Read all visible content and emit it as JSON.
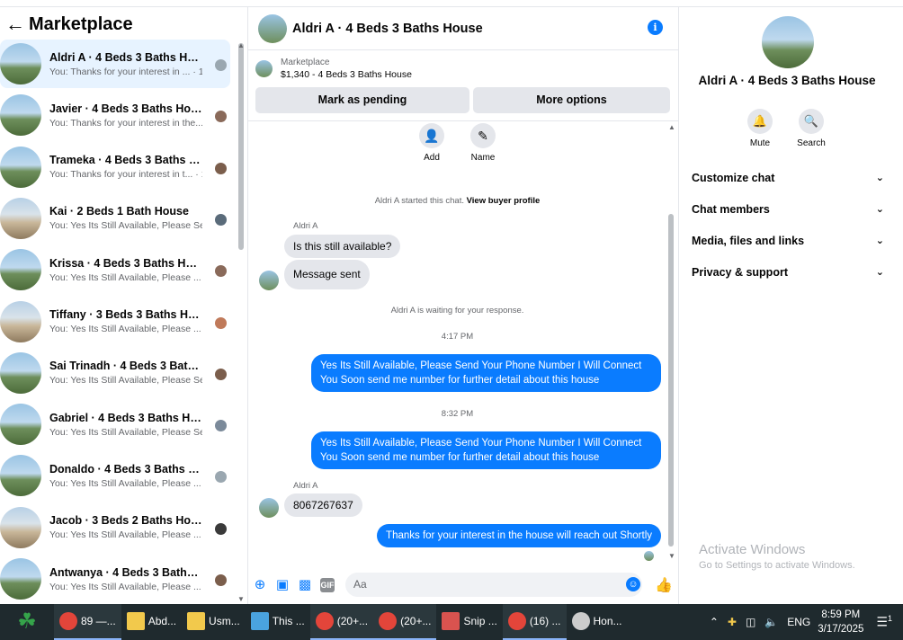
{
  "left": {
    "title": "Marketplace",
    "conversations": [
      {
        "name": "Aldri A · 4 Beds 3 Baths House",
        "preview": "You: Thanks for your interest in ... · 1m"
      },
      {
        "name": "Javier · 4 Beds 3 Baths House",
        "preview": "You: Thanks for your interest in the... · 1m"
      },
      {
        "name": "Trameka · 4 Beds 3 Baths House",
        "preview": "You: Thanks for your interest in t... · 1d"
      },
      {
        "name": "Kai · 2 Beds 1 Bath House",
        "preview": "You: Yes Its Still Available, Please Se... · 1d"
      },
      {
        "name": "Krissa · 4 Beds 3 Baths House",
        "preview": "You: Yes Its Still Available, Please ... · 1d"
      },
      {
        "name": "Tiffany · 3 Beds 3 Baths House",
        "preview": "You: Yes Its Still Available, Please ... · 1d"
      },
      {
        "name": "Sai Trinadh · 4 Beds 3 Baths Hou...",
        "preview": "You: Yes Its Still Available, Please Se... · 1d"
      },
      {
        "name": "Gabriel · 4 Beds 3 Baths House",
        "preview": "You: Yes Its Still Available, Please Se... · 1d"
      },
      {
        "name": "Donaldo · 4 Beds 3 Baths House",
        "preview": "You: Yes Its Still Available, Please ... · 1d"
      },
      {
        "name": "Jacob · 3 Beds 2 Baths House",
        "preview": "You: Yes Its Still Available, Please ... · 1d"
      },
      {
        "name": "Antwanya · 4 Beds 3 Baths Ho...",
        "preview": "You: Yes Its Still Available, Please ... · 1d"
      }
    ]
  },
  "chat": {
    "title": "Aldri A · 4 Beds 3 Baths House",
    "marketplace_label": "Marketplace",
    "listing": "$1,340 - 4 Beds 3 Baths House",
    "mark_pending": "Mark as pending",
    "more_options": "More options",
    "add_label": "Add",
    "name_label": "Name",
    "started_text": "Aldri A started this chat.",
    "view_profile": "View buyer profile",
    "sender1": "Aldri A",
    "msg1": "Is this still available?",
    "msg2": "Message sent",
    "waiting": "Aldri A is waiting for your response.",
    "time1": "4:17 PM",
    "out1": "Yes Its Still Available, Please Send Your Phone Number I Will Connect You Soon        send me number for further detail about this house",
    "time2": "8:32 PM",
    "out2": "Yes Its Still Available, Please Send Your Phone Number I Will Connect You Soon        send me number for further detail about this house",
    "sender2": "Aldri A",
    "msg3": "8067267637",
    "out3": "Thanks for your interest in the house will reach out Shortly",
    "input_placeholder": "Aa"
  },
  "right": {
    "name": "Aldri A · 4 Beds 3 Baths House",
    "mute": "Mute",
    "search": "Search",
    "sections": [
      "Customize chat",
      "Chat members",
      "Media, files and links",
      "Privacy & support"
    ],
    "activate1": "Activate Windows",
    "activate2": "Go to Settings to activate Windows."
  },
  "taskbar": {
    "apps": [
      "89 —...",
      "Abd...",
      "Usm...",
      "This ...",
      "(20+...",
      "(20+...",
      "Snip ...",
      "(16) ...",
      "Hon..."
    ],
    "lang": "ENG",
    "time": "8:59 PM",
    "date": "3/17/2025",
    "notif": "1"
  }
}
